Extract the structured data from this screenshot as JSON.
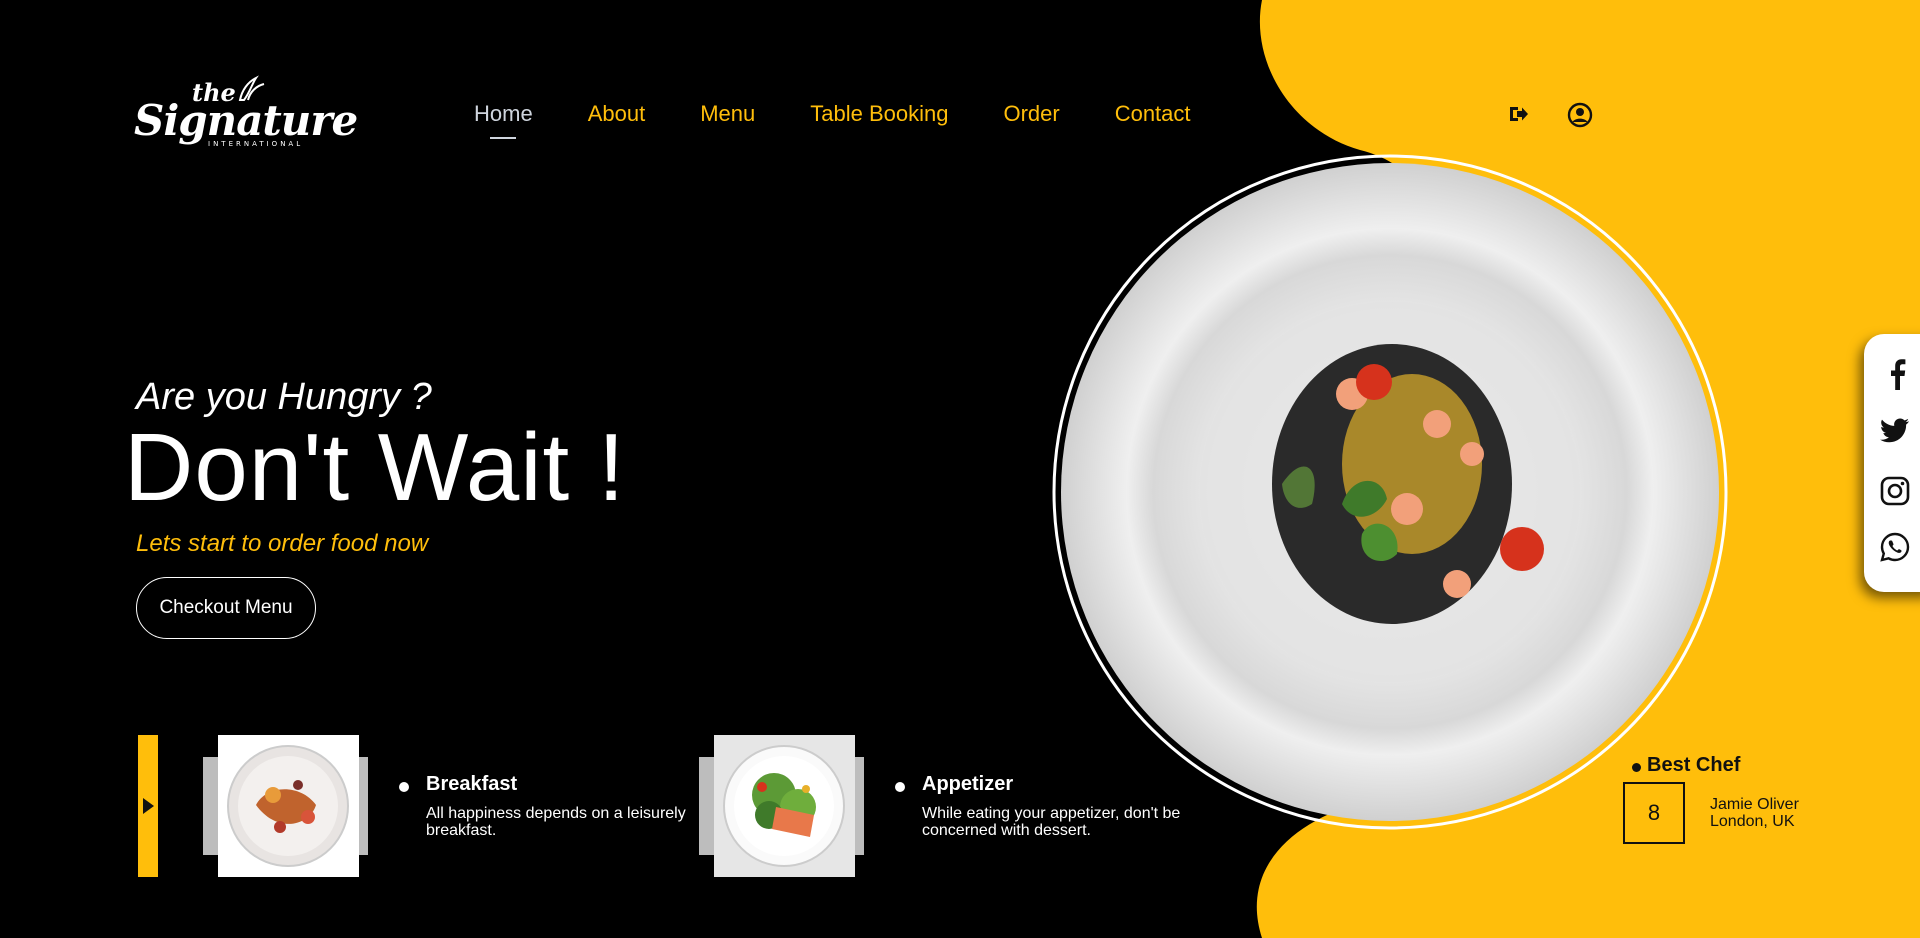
{
  "brand": {
    "logo_the": "the",
    "logo_name": "Signature",
    "logo_sub": "INTERNATIONAL"
  },
  "nav": {
    "items": [
      {
        "label": "Home",
        "active": true
      },
      {
        "label": "About",
        "active": false
      },
      {
        "label": "Menu",
        "active": false
      },
      {
        "label": "Table Booking",
        "active": false
      },
      {
        "label": "Order",
        "active": false
      },
      {
        "label": "Contact",
        "active": false
      }
    ]
  },
  "header_icons": [
    "sign-out-icon",
    "user-circle-icon"
  ],
  "hero": {
    "question": "Are you Hungry ?",
    "title": "Don't Wait !",
    "subtitle": "Lets start to order food now",
    "cta": "Checkout Menu"
  },
  "cards": [
    {
      "title": "Breakfast",
      "description": "All happiness depends on a leisurely breakfast."
    },
    {
      "title": "Appetizer",
      "description": "While eating your appetizer, don't be concerned with dessert."
    }
  ],
  "social": [
    "facebook-icon",
    "twitter-icon",
    "instagram-icon",
    "whatsapp-icon"
  ],
  "chef": {
    "label": "Best Chef",
    "number": "8",
    "name": "Jamie Oliver",
    "location": "London, UK"
  },
  "colors": {
    "accent": "#ffbe0b",
    "background": "#000000",
    "nav_active": "#cfd5de"
  }
}
